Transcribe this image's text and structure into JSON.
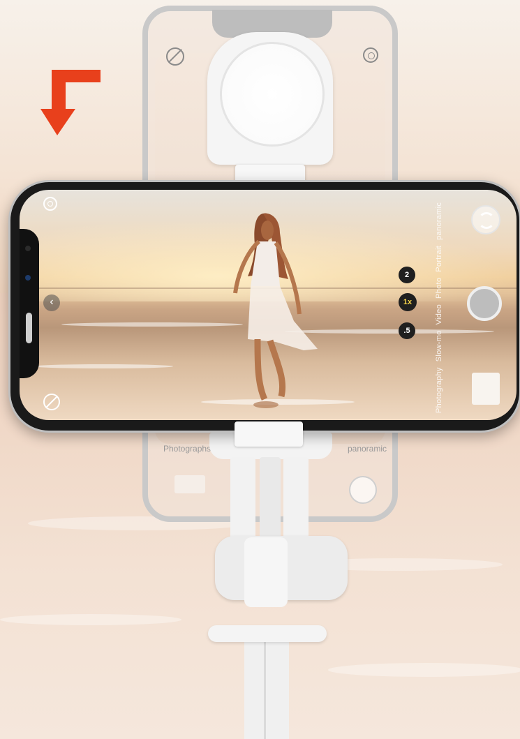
{
  "photo": {
    "subject": "",
    "colors": {
      "sky": "#efd9bd",
      "sea": "#caa585",
      "tripod": "#f2f2f2",
      "arrow": "#e8401c",
      "phone_frame": "#1a1a1a"
    }
  },
  "camera_ui": {
    "zoom_levels": [
      ".5",
      "1x",
      "2"
    ],
    "active_zoom": "1x",
    "modes": [
      "Photography",
      "Slow-mo",
      "Video",
      "Photo",
      "Portrait",
      "panoramic"
    ],
    "ghost_modes": [
      "Photographs",
      "panoramic"
    ],
    "icons": {
      "top_left": "live-photo-icon",
      "bottom_left": "flash-off-icon",
      "collapse": "chevron-left-icon",
      "switch": "switch-camera-icon"
    }
  },
  "annotation": {
    "arrow": "rotate-arrow-icon"
  }
}
